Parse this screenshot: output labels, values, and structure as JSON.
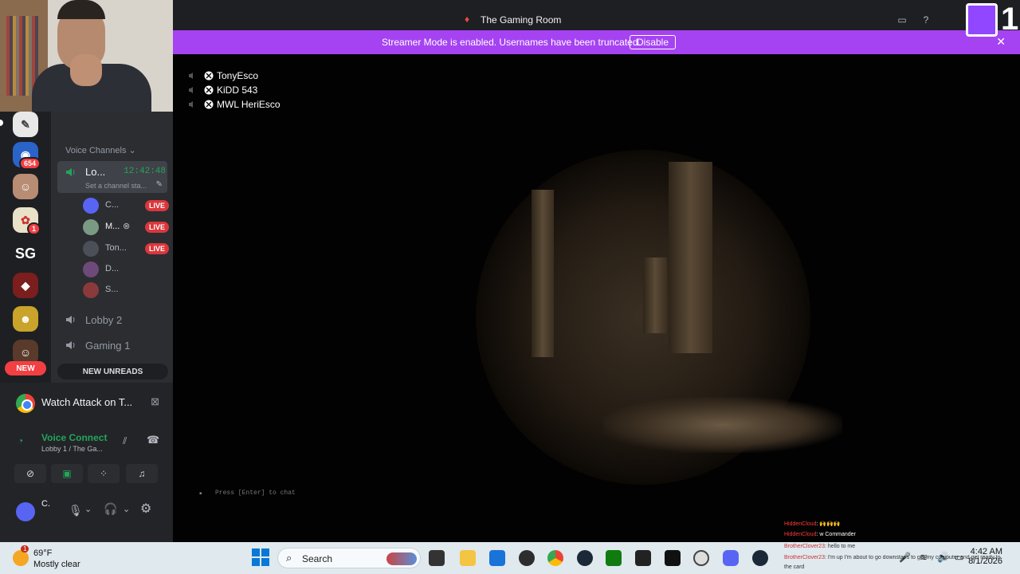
{
  "window": {
    "title": "The Gaming Room",
    "banner_text": "Streamer Mode is enabled. Usernames have been truncated.",
    "banner_button": "Disable"
  },
  "server_rail": {
    "badges": [
      "654",
      "1"
    ],
    "new_label": "NEW"
  },
  "sidebar": {
    "section_header": "Voice Channels",
    "active_channel": {
      "name": "Lo...",
      "timer": "12:42:48",
      "status": "Set a channel sta..."
    },
    "users": [
      {
        "name": "C...",
        "live": "LIVE",
        "color": "#5865f2"
      },
      {
        "name": "M...",
        "live": "LIVE",
        "color": "#7a9a84"
      },
      {
        "name": "Ton...",
        "live": "LIVE",
        "color": "#4a4f58"
      },
      {
        "name": "D...",
        "live": "",
        "color": "#6e4a7a"
      },
      {
        "name": "S...",
        "live": "",
        "color": "#8a3a3a"
      }
    ],
    "channels": [
      "Lobby 2",
      "Gaming 1"
    ],
    "new_unreads": "NEW UNREADS"
  },
  "activity": {
    "watch_label": "Watch Attack on T...",
    "voice_connected": "Voice Connect",
    "voice_location": "Lobby 1 / The Ga...",
    "user_initial": "C."
  },
  "game_overlay": {
    "players": [
      "TonyEsco",
      "KiDD 543",
      "MWL HeriEsco"
    ],
    "chat_prompt": "Press [Enter] to chat",
    "chat_lines": [
      {
        "user": "HiddenCloud",
        "text": ": 🙌🙌🙌"
      },
      {
        "user": "HiddenCloud",
        "text": ": w Commander"
      },
      {
        "user": "BrotherClover23",
        "text": ": hello to me"
      },
      {
        "user": "BrotherClover23",
        "text": ": I'm up I'm about to go downstairs to get my computer and get ready to"
      },
      {
        "user": "",
        "text": "the card"
      }
    ]
  },
  "taskbar": {
    "weather_temp": "69°F",
    "weather_desc": "Mostly clear",
    "weather_badge": "1",
    "search_label": "Search",
    "time": "4:42 AM",
    "date": "8/1/2026"
  },
  "twitch": {
    "count": "1"
  }
}
